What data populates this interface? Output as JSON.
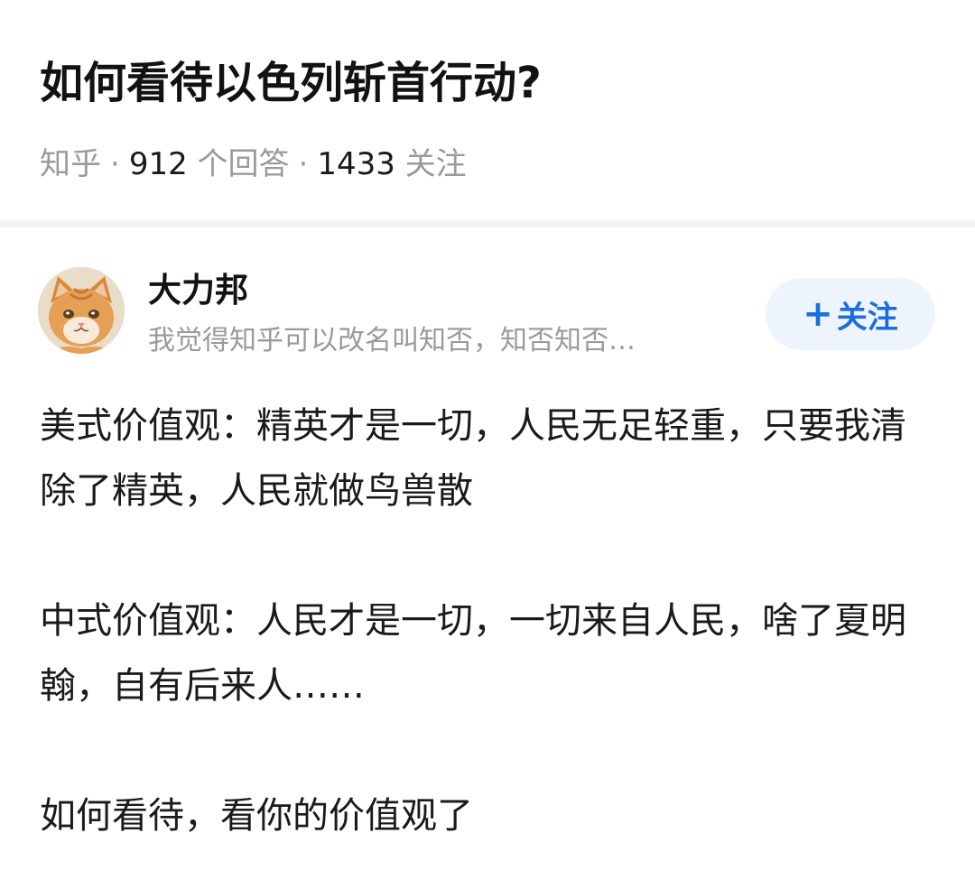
{
  "question": {
    "title": "如何看待以色列斩首行动?",
    "source": "知乎",
    "separator": "·",
    "answer_count": "912",
    "answer_label": "个回答",
    "follower_count": "1433",
    "follower_label": "关注"
  },
  "answer": {
    "author_name": "大力邦",
    "author_bio": "我觉得知乎可以改名叫知否，知否知否…",
    "follow_plus": "+",
    "follow_label": "关注",
    "paragraphs": [
      "美式价值观：精英才是一切，人民无足轻重，只要我清除了精英，人民就做鸟兽散",
      "中式价值观：人民才是一切，一切来自人民，啥了夏明翰，自有后来人……",
      "如何看待，看你的价值观了"
    ]
  },
  "colors": {
    "accent": "#1a6fe0",
    "follow_bg": "#eef4fb",
    "meta_gray": "#9a9a9a"
  },
  "icons": {
    "avatar": "orange-cat-avatar"
  }
}
